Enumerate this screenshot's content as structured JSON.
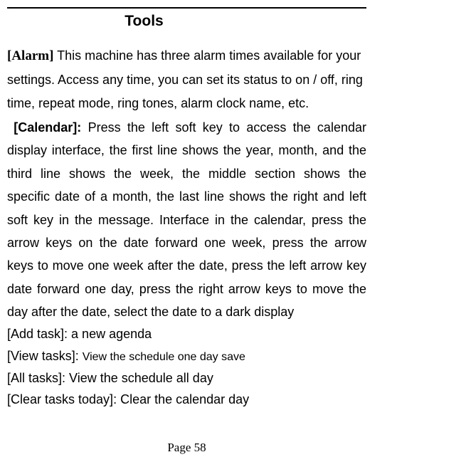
{
  "title": "Tools",
  "alarm": {
    "label": "[Alarm]",
    "text": " This machine has three alarm times available for your settings. Access any time, you can set its status to on / off, ring time, repeat mode, ring tones, alarm clock name, etc."
  },
  "calendar": {
    "label": "[Calendar]:",
    "text": " Press the left soft key to access the calendar display interface, the first line shows the year, month, and the third line shows the week, the middle section shows the specific date of a month, the last line shows the right and left soft key in the message. Interface in the calendar, press the arrow keys on the date forward one week, press the arrow keys to move one week after the date, press the left arrow key date forward one day, press the right arrow keys to move the day after the date, select the date to a dark display"
  },
  "tasks": [
    {
      "label": "[Add task]: ",
      "text": "a new agenda"
    },
    {
      "label": "[View tasks]: ",
      "text": "View the schedule one day save"
    },
    {
      "label": "[All tasks]: ",
      "text": "View the schedule all day"
    },
    {
      "label": "[Clear tasks today]: ",
      "text": "Clear the calendar day"
    }
  ],
  "page_number": "Page 58"
}
